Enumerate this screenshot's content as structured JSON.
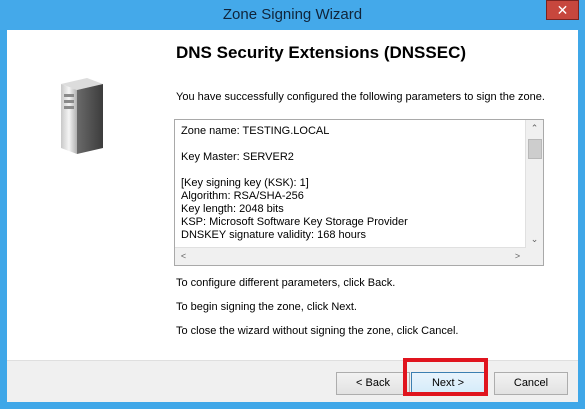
{
  "window": {
    "title": "Zone Signing Wizard",
    "close_glyph": "✕"
  },
  "page": {
    "heading": "DNS Security Extensions (DNSSEC)",
    "intro": "You have successfully configured the following parameters to sign the zone.",
    "params": [
      "Zone name: TESTING.LOCAL",
      "",
      "Key Master: SERVER2",
      "",
      "[Key signing key (KSK): 1]",
      "Algorithm: RSA/SHA-256",
      "Key length: 2048 bits",
      "KSP: Microsoft Software Key Storage Provider",
      "DNSKEY signature validity: 168 hours"
    ],
    "instructions": [
      "To configure different parameters, click Back.",
      "To begin signing the zone, click Next.",
      "To close the wizard without signing the zone, click Cancel."
    ]
  },
  "scroll": {
    "up": "⌃",
    "down": "⌄",
    "left": "<",
    "right": ">"
  },
  "buttons": {
    "back": "< Back",
    "next": "Next >",
    "cancel": "Cancel"
  },
  "icons": {
    "server": "server-icon"
  },
  "colors": {
    "frame": "#3fa7e8",
    "close": "#c7473d",
    "highlight": "#e0141e"
  }
}
